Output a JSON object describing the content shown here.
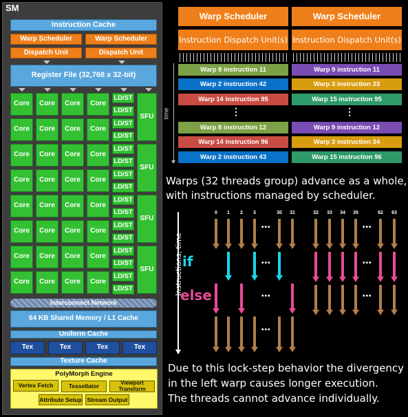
{
  "sm": {
    "title": "SM",
    "instruction_cache": "Instruction Cache",
    "warp_schedulers": [
      "Warp Scheduler",
      "Warp Scheduler"
    ],
    "dispatch_units": [
      "Dispatch Unit",
      "Dispatch Unit"
    ],
    "register_file": "Register File (32,768 x 32-bit)",
    "core_label": "Core",
    "ldst_label": "LD/ST",
    "sfu_label": "SFU",
    "core_rows": 8,
    "cores_per_row": 4,
    "ldst_units": 16,
    "sfu_units": 4,
    "interconnect": "Interconnect Network",
    "shared_memory": "64 KB Shared Memory / L1 Cache",
    "uniform_cache": "Uniform Cache",
    "tex_units": [
      "Tex",
      "Tex",
      "Tex",
      "Tex"
    ],
    "texture_cache": "Texture Cache",
    "polymorph": {
      "title": "PolyMorph Engine",
      "vertex_fetch": "Vertex Fetch",
      "tessellator": "Tessellator",
      "viewport_transform": "Viewport Transform",
      "attribute_setup": "Attribute Setup",
      "stream_output": "Stream Output"
    },
    "colors": {
      "panel": "#3d3d3d",
      "cache": "#5aa7dd",
      "scheduler": "#ef7f1a",
      "core": "#33c133",
      "tex": "#1f4f9e",
      "polymorph": "#fff86a"
    }
  },
  "scheduling": {
    "time_label": "time",
    "columns": [
      {
        "scheduler": "Warp Scheduler",
        "dispatch": "Instruction Dispatch Unit(s)",
        "instructions_before": [
          {
            "label": "Warp 8 instruction 11",
            "color": "#7da146"
          },
          {
            "label": "Warp 2 instruction 42",
            "color": "#0a72c8"
          },
          {
            "label": "Warp 14 instruction 95",
            "color": "#c94c43"
          }
        ],
        "instructions_after": [
          {
            "label": "Warp 8 instruction 12",
            "color": "#7da146"
          },
          {
            "label": "Warp 14 instruction 96",
            "color": "#c94c43"
          },
          {
            "label": "Warp 2 instruction 43",
            "color": "#0a72c8"
          }
        ]
      },
      {
        "scheduler": "Warp Scheduler",
        "dispatch": "Instruction Dispatch Unit(s)",
        "instructions_before": [
          {
            "label": "Warp 9 instruction 11",
            "color": "#7a4db3"
          },
          {
            "label": "Warp 3 instruction 33",
            "color": "#d79c10"
          },
          {
            "label": "Warp 15 instruction 95",
            "color": "#2e9a6a"
          }
        ],
        "instructions_after": [
          {
            "label": "Warp 9 instruction 12",
            "color": "#7a4db3"
          },
          {
            "label": "Warp 3 instruction 34",
            "color": "#d79c10"
          },
          {
            "label": "Warp 15 instruction 96",
            "color": "#2e9a6a"
          }
        ]
      }
    ],
    "ellipsis": "⋮"
  },
  "caption_top": [
    "Warps (32 threads group) advance as a whole,",
    "with instructions managed by scheduler."
  ],
  "divergence": {
    "axis_label": "Instructions, time",
    "if_label": "if",
    "else_label": "else",
    "ellipsis": "•••",
    "warp_a_threads": [
      "0",
      "1",
      "2",
      "3",
      "30",
      "31"
    ],
    "warp_b_threads": [
      "32",
      "33",
      "34",
      "35",
      "62",
      "63"
    ],
    "warp_a_if_threads": [
      "1",
      "3",
      "30"
    ],
    "warp_a_else_threads": [
      "0",
      "2",
      "31"
    ],
    "colors": {
      "normal": "#b07f4a",
      "if": "#1ad5e8",
      "else": "#ea4a9a"
    }
  },
  "caption_bottom": [
    "Due to this lock-step behavior the divergency",
    "in the left warp causes longer execution.",
    "The threads cannot advance individually."
  ]
}
